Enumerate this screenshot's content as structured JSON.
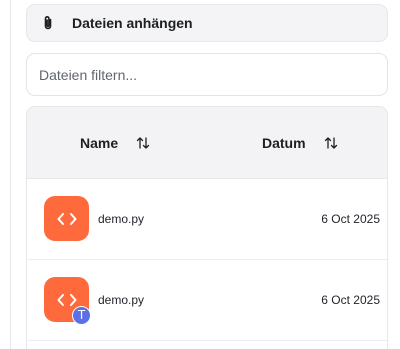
{
  "attach": {
    "label": "Dateien anhängen",
    "icon": "paperclip-icon"
  },
  "filter": {
    "placeholder": "Dateien filtern...",
    "value": ""
  },
  "table": {
    "columns": [
      {
        "label": "Name",
        "sort_icon": "sort-arrows-icon"
      },
      {
        "label": "Datum",
        "sort_icon": "sort-arrows-icon"
      }
    ],
    "rows": [
      {
        "name": "demo.py",
        "date": "6 Oct 2025",
        "icon": "code-file-icon",
        "badge": ""
      },
      {
        "name": "demo.py",
        "date": "6 Oct 2025",
        "icon": "code-file-icon",
        "badge": "T"
      }
    ]
  },
  "colors": {
    "file_icon_bg": "#ff6a3d",
    "badge_bg": "#5b6fe6",
    "header_bg": "#f3f3f5"
  }
}
